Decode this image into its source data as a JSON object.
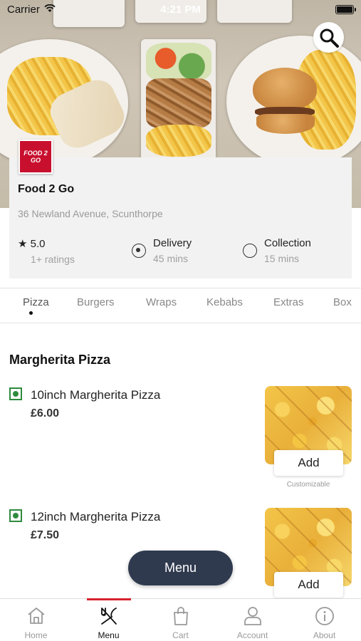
{
  "status_bar": {
    "carrier": "Carrier",
    "time": "4:21 PM"
  },
  "restaurant": {
    "logo_text_line1": "FOOD 2",
    "logo_text_line2": "GO",
    "name": "Food 2 Go",
    "address": "36 Newland Avenue, Scunthorpe",
    "rating": "5.0",
    "rating_count": "1+ ratings",
    "delivery_label": "Delivery",
    "delivery_time": "45 mins",
    "collection_label": "Collection",
    "collection_time": "15 mins",
    "selected_mode": "Delivery"
  },
  "categories": [
    "Pizza",
    "Burgers",
    "Wraps",
    "Kebabs",
    "Extras",
    "Box"
  ],
  "active_category": "Pizza",
  "section_title": "Margherita Pizza",
  "items": [
    {
      "name": "10inch Margherita Pizza",
      "price": "£6.00",
      "add_label": "Add",
      "note": "Customizable"
    },
    {
      "name": "12inch Margherita Pizza",
      "price": "£7.50",
      "add_label": "Add"
    }
  ],
  "menu_button": "Menu",
  "bottom_nav": [
    {
      "label": "Home",
      "icon": "home-icon"
    },
    {
      "label": "Menu",
      "icon": "fork-knife-icon"
    },
    {
      "label": "Cart",
      "icon": "bag-icon"
    },
    {
      "label": "Account",
      "icon": "user-icon"
    },
    {
      "label": "About",
      "icon": "info-icon"
    }
  ],
  "active_nav": "Menu",
  "colors": {
    "accent": "#d6232e",
    "veg": "#2e8b3e",
    "fab": "#303a4f",
    "logo": "#c8102e"
  }
}
